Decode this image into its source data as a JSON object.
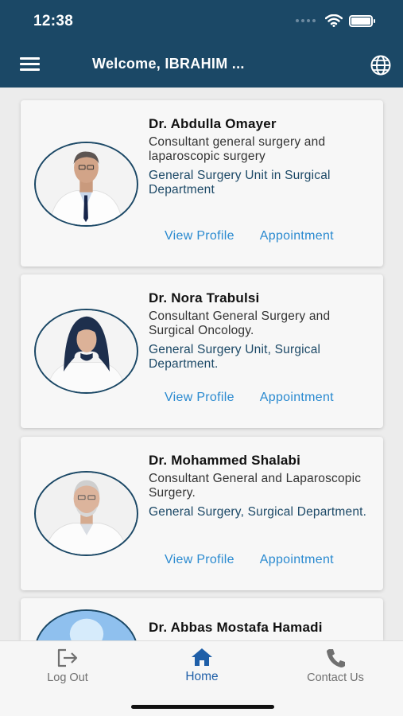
{
  "status_bar": {
    "time": "12:38"
  },
  "header": {
    "welcome_text": "Welcome, IBRAHIM ..."
  },
  "doctors": [
    {
      "name": "Dr. Abdulla Omayer",
      "title": "Consultant general surgery and laparoscopic surgery",
      "department": "General Surgery Unit in Surgical Department",
      "view_profile": "View Profile",
      "appointment": "Appointment"
    },
    {
      "name": "Dr. Nora Trabulsi",
      "title": "Consultant General Surgery and Surgical Oncology.",
      "department": "General Surgery Unit, Surgical Department.",
      "view_profile": "View Profile",
      "appointment": "Appointment"
    },
    {
      "name": "Dr. Mohammed Shalabi",
      "title": "Consultant General and Laparoscopic Surgery.",
      "department": "General Surgery, Surgical Department.",
      "view_profile": "View Profile",
      "appointment": "Appointment"
    },
    {
      "name": "Dr. Abbas Mostafa Hamadi"
    }
  ],
  "tabs": [
    {
      "label": "Log Out",
      "icon": "logout-icon"
    },
    {
      "label": "Home",
      "icon": "home-icon",
      "active": true
    },
    {
      "label": "Contact Us",
      "icon": "phone-icon"
    }
  ],
  "colors": {
    "header": "#1b4866",
    "link": "#2a8ad0",
    "active_tab": "#1f5fa8"
  }
}
